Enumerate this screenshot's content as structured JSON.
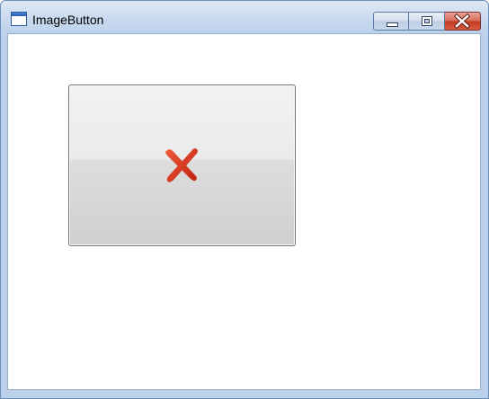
{
  "window": {
    "title": "ImageButton",
    "icon": "window-app-icon"
  },
  "caption_buttons": {
    "minimize_icon": "minimize-icon",
    "maximize_icon": "maximize-icon",
    "close_icon": "close-icon"
  },
  "content": {
    "image_button": {
      "icon": "x-mark-icon",
      "icon_color": "#d8321c"
    }
  },
  "colors": {
    "close_button": "#c23b22",
    "frame": "#bcd1ea"
  }
}
